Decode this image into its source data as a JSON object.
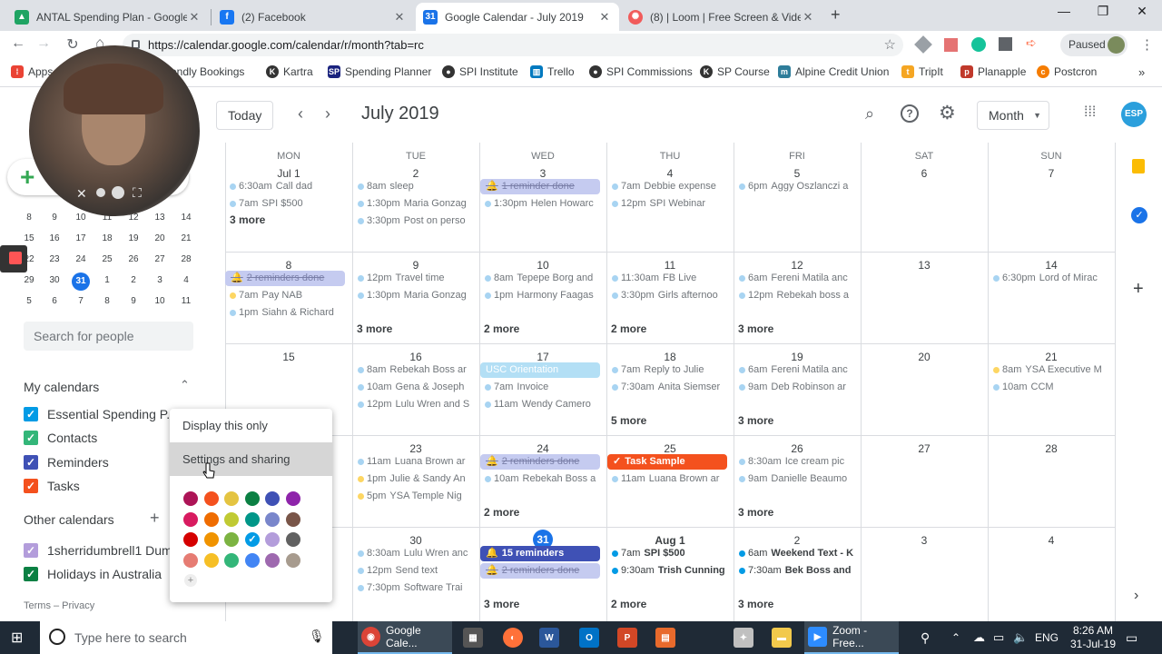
{
  "browser": {
    "tabs": [
      {
        "title": "ANTAL Spending Plan - Google D",
        "icon": "drive-icon",
        "color": "#1fa463"
      },
      {
        "title": "(2) Facebook",
        "icon": "facebook-icon",
        "color": "#1877f2"
      },
      {
        "title": "Google Calendar - July 2019",
        "icon": "calendar-icon",
        "color": "#1a73e8"
      },
      {
        "title": "(8) | Loom | Free Screen & Video",
        "icon": "loom-icon",
        "color": "#f15b5b"
      }
    ],
    "url": "https://calendar.google.com/calendar/r/month?tab=rc",
    "profile_label": "Paused",
    "bookmarks": [
      {
        "label": "Apps",
        "color": "#ea4335"
      },
      {
        "label": "Calendly Bookings",
        "color": "#006bff"
      },
      {
        "label": "Kartra",
        "color": "#333333"
      },
      {
        "label": "Spending Planner",
        "color": "#1a237e"
      },
      {
        "label": "SPI Institute",
        "color": "#333333"
      },
      {
        "label": "Trello",
        "color": "#0079bf"
      },
      {
        "label": "SPI Commissions",
        "color": "#333333"
      },
      {
        "label": "SP Course",
        "color": "#333333"
      },
      {
        "label": "Alpine Credit Union",
        "color": "#2e7d9a"
      },
      {
        "label": "TripIt",
        "color": "#f5a623"
      },
      {
        "label": "Planapple",
        "color": "#c0392b"
      },
      {
        "label": "Postcron",
        "color": "#f57c00"
      }
    ]
  },
  "header": {
    "today_label": "Today",
    "title": "July 2019",
    "view_label": "Month",
    "avatar_text": "ESP"
  },
  "sidebar": {
    "mini_rows": [
      [
        "8",
        "9",
        "10",
        "11",
        "12",
        "13",
        "14"
      ],
      [
        "15",
        "16",
        "17",
        "18",
        "19",
        "20",
        "21"
      ],
      [
        "22",
        "23",
        "24",
        "25",
        "26",
        "27",
        "28"
      ],
      [
        "29",
        "30",
        "31",
        "1",
        "2",
        "3",
        "4"
      ],
      [
        "5",
        "6",
        "7",
        "8",
        "9",
        "10",
        "11"
      ]
    ],
    "search_placeholder": "Search for people",
    "my_calendars_label": "My calendars",
    "my_calendars": [
      {
        "label": "Essential Spending P...",
        "color": "#039be5"
      },
      {
        "label": "Contacts",
        "color": "#33b679"
      },
      {
        "label": "Reminders",
        "color": "#3f51b5"
      },
      {
        "label": "Tasks",
        "color": "#f4511e"
      }
    ],
    "other_calendars_label": "Other calendars",
    "other_calendars": [
      {
        "label": "1sherridumbrell1 Dumb",
        "color": "#b39ddb"
      },
      {
        "label": "Holidays in Australia",
        "color": "#0b8043"
      }
    ],
    "footer": "Terms – Privacy"
  },
  "grid": {
    "day_names": [
      "MON",
      "TUE",
      "WED",
      "THU",
      "FRI",
      "SAT",
      "SUN"
    ],
    "weeks": [
      {
        "dates": [
          "Jul 1",
          "2",
          "3",
          "4",
          "5",
          "6",
          "7"
        ],
        "events": [
          [
            {
              "t": "6:30am",
              "n": "Call dad"
            },
            {
              "t": "7am",
              "n": "SPI $500"
            }
          ],
          [
            {
              "t": "8am",
              "n": "sleep"
            },
            {
              "t": "1:30pm",
              "n": "Maria Gonzag"
            },
            {
              "t": "3:30pm",
              "n": "Post on perso"
            }
          ],
          [
            {
              "t": "",
              "n": "1 reminder done",
              "kind": "reminder-done"
            },
            {
              "t": "1:30pm",
              "n": "Helen Howarc"
            }
          ],
          [
            {
              "t": "7am",
              "n": "Debbie expense"
            },
            {
              "t": "12pm",
              "n": "SPI Webinar"
            }
          ],
          [
            {
              "t": "6pm",
              "n": "Aggy Oszlanczi a"
            }
          ],
          [],
          []
        ],
        "more": [
          "3 more",
          "",
          "",
          "",
          "",
          "",
          ""
        ]
      },
      {
        "dates": [
          "8",
          "9",
          "10",
          "11",
          "12",
          "13",
          "14"
        ],
        "events": [
          [
            {
              "t": "",
              "n": "2 reminders done",
              "kind": "reminder-done"
            },
            {
              "t": "7am",
              "n": "Pay NAB",
              "dot": "#fdd663"
            },
            {
              "t": "1pm",
              "n": "Siahn & Richard"
            }
          ],
          [
            {
              "t": "12pm",
              "n": "Travel time"
            },
            {
              "t": "1:30pm",
              "n": "Maria Gonzag"
            }
          ],
          [
            {
              "t": "8am",
              "n": "Tepepe Borg and"
            },
            {
              "t": "1pm",
              "n": "Harmony Faagas"
            }
          ],
          [
            {
              "t": "11:30am",
              "n": "FB Live"
            },
            {
              "t": "3:30pm",
              "n": "Girls afternoo"
            }
          ],
          [
            {
              "t": "6am",
              "n": "Fereni Matila anc"
            },
            {
              "t": "12pm",
              "n": "Rebekah boss a"
            }
          ],
          [],
          [
            {
              "t": "6:30pm",
              "n": "Lord of Mirac"
            }
          ]
        ],
        "more": [
          "",
          "3 more",
          "2 more",
          "2 more",
          "3 more",
          "",
          ""
        ]
      },
      {
        "dates": [
          "15",
          "16",
          "17",
          "18",
          "19",
          "20",
          "21"
        ],
        "events": [
          [],
          [
            {
              "t": "8am",
              "n": "Rebekah Boss ar"
            },
            {
              "t": "10am",
              "n": "Gena & Joseph"
            },
            {
              "t": "12pm",
              "n": "Lulu Wren and S"
            }
          ],
          [
            {
              "t": "",
              "n": "USC Orientation",
              "kind": "allday"
            },
            {
              "t": "7am",
              "n": "Invoice"
            },
            {
              "t": "11am",
              "n": "Wendy Camero"
            }
          ],
          [
            {
              "t": "7am",
              "n": "Reply to Julie"
            },
            {
              "t": "7:30am",
              "n": "Anita Siemser"
            }
          ],
          [
            {
              "t": "6am",
              "n": "Fereni Matila anc"
            },
            {
              "t": "9am",
              "n": "Deb Robinson ar"
            }
          ],
          [],
          [
            {
              "t": "8am",
              "n": "YSA Executive M",
              "dot": "#fdd663"
            },
            {
              "t": "10am",
              "n": "CCM"
            }
          ]
        ],
        "more": [
          "",
          "",
          "",
          "5 more",
          "3 more",
          "",
          ""
        ]
      },
      {
        "dates": [
          "22",
          "23",
          "24",
          "25",
          "26",
          "27",
          "28"
        ],
        "events": [
          [
            {
              "t": "",
              "n": "ne"
            },
            {
              "t": "",
              "n": "ne"
            },
            {
              "t": "",
              "n": "d"
            }
          ],
          [
            {
              "t": "11am",
              "n": "Luana Brown ar"
            },
            {
              "t": "1pm",
              "n": "Julie & Sandy An",
              "dot": "#fdd663"
            },
            {
              "t": "5pm",
              "n": "YSA Temple Nig",
              "dot": "#fdd663"
            }
          ],
          [
            {
              "t": "",
              "n": "2 reminders done",
              "kind": "reminder-done"
            },
            {
              "t": "10am",
              "n": "Rebekah Boss a"
            }
          ],
          [
            {
              "t": "",
              "n": "Task Sample",
              "kind": "task"
            },
            {
              "t": "11am",
              "n": "Luana Brown ar"
            }
          ],
          [
            {
              "t": "8:30am",
              "n": "Ice cream pic"
            },
            {
              "t": "9am",
              "n": "Danielle Beaumo"
            }
          ],
          [],
          []
        ],
        "more": [
          "",
          "",
          "2 more",
          "",
          "3 more",
          "",
          ""
        ]
      },
      {
        "dates": [
          "29",
          "30",
          "31",
          "Aug 1",
          "2",
          "3",
          "4"
        ],
        "events": [
          [
            {
              "t": "",
              "n": "ne"
            },
            {
              "t": "",
              "n": "nc"
            },
            {
              "t": "",
              "n": "d"
            }
          ],
          [
            {
              "t": "8:30am",
              "n": "Lulu Wren anc"
            },
            {
              "t": "12pm",
              "n": "Send text"
            },
            {
              "t": "7:30pm",
              "n": "Software Trai"
            }
          ],
          [
            {
              "t": "",
              "n": "15 reminders",
              "kind": "reminder"
            },
            {
              "t": "",
              "n": "2 reminders done",
              "kind": "reminder-done"
            }
          ],
          [
            {
              "t": "7am",
              "n": "SPI $500",
              "bold": true
            },
            {
              "t": "9:30am",
              "n": "Trish Cunning",
              "bold": true
            }
          ],
          [
            {
              "t": "6am",
              "n": "Weekend Text - K",
              "bold": true
            },
            {
              "t": "7:30am",
              "n": "Bek Boss and",
              "bold": true
            }
          ],
          [],
          []
        ],
        "more": [
          "",
          "",
          "3 more",
          "2 more",
          "3 more",
          "",
          ""
        ]
      }
    ]
  },
  "popup": {
    "items": [
      "Display this only",
      "Settings and sharing"
    ],
    "swatches": [
      [
        "#ad1457",
        "#f4511e",
        "#e4c441",
        "#0b8043",
        "#3f51b5",
        "#8e24aa"
      ],
      [
        "#d81b60",
        "#ef6c00",
        "#c0ca33",
        "#009688",
        "#7986cb",
        "#795548"
      ],
      [
        "#d50000",
        "#f09300",
        "#7cb342",
        "#039be5",
        "#b39ddb",
        "#616161"
      ],
      [
        "#e67c73",
        "#f6bf26",
        "#33b679",
        "#4285f4",
        "#9e69af",
        "#a79b8e"
      ]
    ],
    "selected_swatch": "#039be5",
    "add_custom": "+"
  },
  "taskbar": {
    "search_placeholder": "Type here to search",
    "chrome_label": "Google Cale...",
    "zoom_label": "Zoom - Free...",
    "lang": "ENG",
    "time": "8:26 AM",
    "date": "31-Jul-19"
  }
}
